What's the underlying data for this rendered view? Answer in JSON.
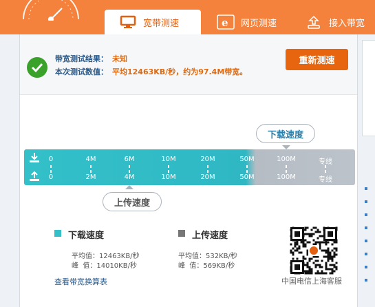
{
  "header": {
    "tabs": [
      {
        "label": "宽带测速",
        "icon": "monitor-icon",
        "active": true
      },
      {
        "label": "网页测速",
        "icon": "ie-icon",
        "active": false
      },
      {
        "label": "接入带宽",
        "icon": "upload-icon",
        "active": false
      }
    ]
  },
  "result": {
    "line1_label": "带宽测试结果：",
    "line1_value": "未知",
    "line2_label": "本次测试数值：",
    "line2_value": "平均12463KB/秒，约为97.4M带宽。",
    "retest_label": "重新测速"
  },
  "meter": {
    "download_bubble": "下载速度",
    "upload_bubble": "上传速度",
    "download_ticks": [
      "0",
      "4M",
      "6M",
      "10M",
      "20M",
      "50M",
      "100M",
      "专线"
    ],
    "upload_ticks": [
      "0",
      "2M",
      "4M",
      "10M",
      "20M",
      "50M",
      "100M",
      "专线"
    ]
  },
  "stats": {
    "download": {
      "title": "下载速度",
      "avg_label": "平均值：",
      "avg_value": "12463KB/秒",
      "peak_label": "峰  值：",
      "peak_value": "14010KB/秒",
      "color": "#33c0c9"
    },
    "upload": {
      "title": "上传速度",
      "avg_label": "平均值：",
      "avg_value": "532KB/秒",
      "peak_label": "峰  值：",
      "peak_value": "569KB/秒",
      "color": "#777777"
    }
  },
  "link_label": "查看带宽换算表",
  "qr_caption": "中国电信上海客服",
  "colors": {
    "accent": "#f5823c",
    "button": "#e8650f",
    "meter": "#33c0c9"
  }
}
